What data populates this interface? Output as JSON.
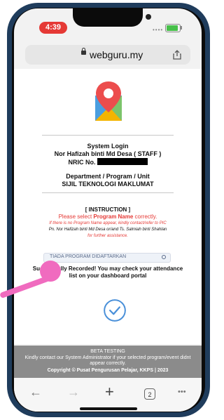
{
  "status_bar": {
    "time": "4:39"
  },
  "browser": {
    "url": "webguru.my",
    "tab_count": "2",
    "nav": {
      "back_icon": "←",
      "forward_icon": "→",
      "new_tab_icon": "+",
      "more_icon": "•••"
    }
  },
  "login": {
    "title": "System Login",
    "staff_name": "Nor Hafizah binti Md Desa ( STAFF )",
    "nric_label": "NRIC No."
  },
  "department": {
    "label": "Department / Program / Unit",
    "value": "SIJIL TEKNOLOGI MAKLUMAT"
  },
  "instruction": {
    "title": "[ INSTRUCTION ]",
    "select_prefix": "Please select ",
    "select_emphasis": "Program Name",
    "select_suffix": " correctly.",
    "note_line1": "If there is no Program Name appear, kindly contact/refer to PIC",
    "note_line2": "Pn. Nor Hafizah binti Md Desa or/and Ts. Salmiah binti Shahlan",
    "note_line3": "for further assistance."
  },
  "program_select": {
    "value": "TIADA PROGRAM DIDAFTARKAN"
  },
  "message": {
    "line1": "Successfully Recorded! You may check your attendance",
    "line2": "list on your dashboard portal"
  },
  "footer": {
    "beta": "BETA TESTING",
    "contact_line1": "Kindly contact our System Administrator if your selected program/event didnt",
    "contact_line2": "appear correctly.",
    "copyright": "Copyright © Pusat Pengurusan Pelajar, KKPS | 2023"
  },
  "colors": {
    "accent_red": "#e53935",
    "check_blue": "#4a90d9",
    "touch_marker": "#f06bbf"
  }
}
